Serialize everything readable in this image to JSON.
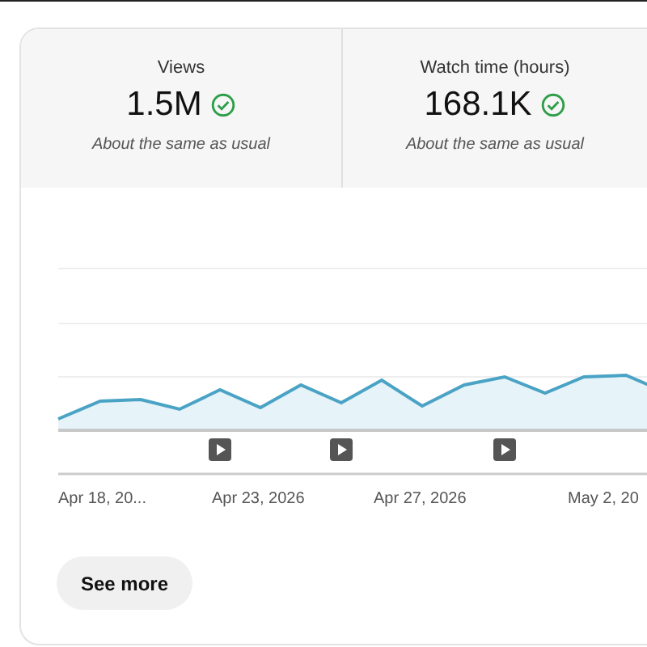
{
  "metrics": [
    {
      "label": "Views",
      "value": "1.5M",
      "note": "About the same as usual"
    },
    {
      "label": "Watch time (hours)",
      "value": "168.1K",
      "note": "About the same as usual"
    }
  ],
  "chart": {
    "x_labels": [
      "Apr 18, 20...",
      "Apr 23, 2026",
      "Apr 27, 2026",
      "May 2, 20"
    ]
  },
  "button": "See more"
}
